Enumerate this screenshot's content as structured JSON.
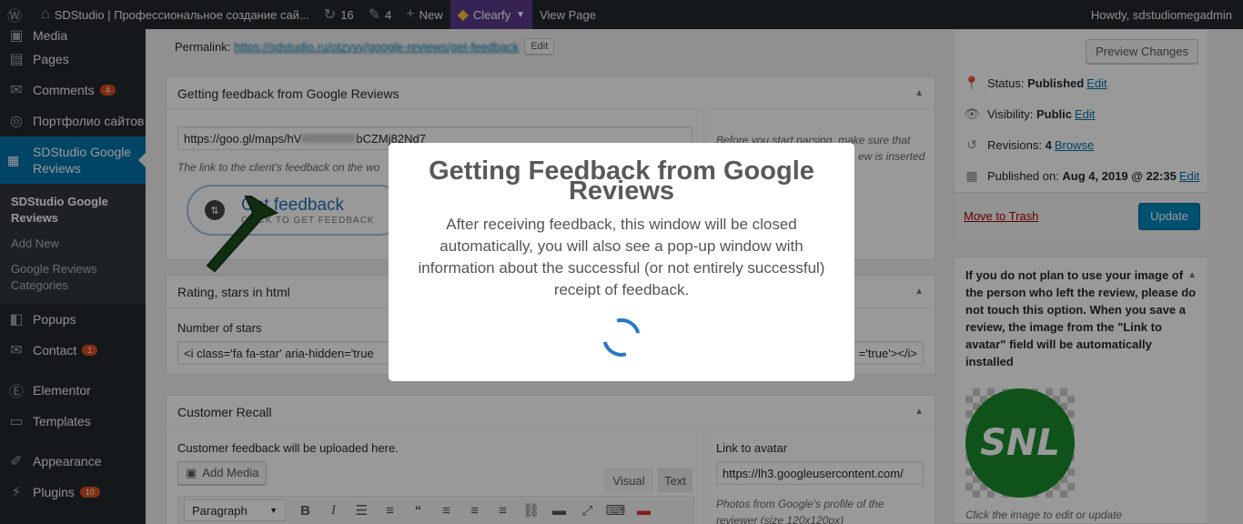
{
  "adminbar": {
    "wp_logo": "wordpress-icon",
    "site_title": "SDStudio | Профессиональное создание сай...",
    "updates": "16",
    "comments": "4",
    "new_label": "New",
    "clearfy_label": "Clearfy",
    "view_page": "View Page",
    "howdy": "Howdy, sdstudiomegadmin"
  },
  "menu": {
    "top_items": [
      {
        "label": "Media",
        "icon": "media-icon"
      },
      {
        "label": "Pages",
        "icon": "pages-icon"
      },
      {
        "label": "Comments",
        "icon": "comments-icon",
        "badge": "4"
      },
      {
        "label": "Портфолио сайтов",
        "icon": "portfolio-icon"
      }
    ],
    "current": {
      "label": "SDStudio Google Reviews",
      "icon": "reviews-icon"
    },
    "submenu": [
      "SDStudio Google Reviews",
      "Add New",
      "Google Reviews Categories"
    ],
    "bottom_items": [
      {
        "label": "Popups",
        "icon": "popups-icon"
      },
      {
        "label": "Contact",
        "icon": "contact-icon",
        "badge": "1"
      },
      {
        "label": "Elementor",
        "icon": "elementor-icon"
      },
      {
        "label": "Templates",
        "icon": "templates-icon"
      },
      {
        "label": "Appearance",
        "icon": "appearance-icon"
      },
      {
        "label": "Plugins",
        "icon": "plugins-icon",
        "badge": "10"
      }
    ]
  },
  "permalink": {
    "label": "Permalink:",
    "url": "https://sdstudio.ru/otzyvy/google-reviews/get-feedback",
    "edit": "Edit"
  },
  "feedback_box": {
    "title": "Getting feedback from Google Reviews",
    "url_value": "https://goo.gl/maps/hV",
    "url_value_tail": "bCZMj82Nd7",
    "hint": "The link to the client's feedback on the wo",
    "side_note": "Before you start parsing, make sure that",
    "side_note_2": "ew is inserted",
    "button_title": "Get feedback",
    "button_sub": "CLICK TO GET FEEDBACK"
  },
  "rating_box": {
    "title": "Rating, stars in html",
    "label": "Number of stars",
    "value": "<i class='fa fa-star' aria-hidden='true",
    "value_right": "='true'></i>"
  },
  "recall_box": {
    "title": "Customer Recall",
    "desc": "Customer feedback will be uploaded here.",
    "add_media": "Add Media",
    "tab_visual": "Visual",
    "tab_text": "Text",
    "format": "Paragraph",
    "avatar_label": "Link to avatar",
    "avatar_value": "https://lh3.googleusercontent.com/",
    "avatar_note": "Photos from Google's profile of the reviewer (size 120x120px)"
  },
  "publish": {
    "preview": "Preview Changes",
    "status_label": "Status:",
    "status_value": "Published",
    "visibility_label": "Visibility:",
    "visibility_value": "Public",
    "revisions_label": "Revisions:",
    "revisions_value": "4",
    "browse": "Browse",
    "published_label": "Published on:",
    "published_value": "Aug 4, 2019 @ 22:35",
    "edit": "Edit",
    "trash": "Move to Trash",
    "update": "Update"
  },
  "image_box": {
    "text": "If you do not plan to use your image of the person who left the review, please do not touch this option. When you save a review, the image from the \"Link to avatar\" field will be automatically installed",
    "footer": "Click the image to edit or update",
    "logo_text": "SNL"
  },
  "modal": {
    "title": "Getting Feedback from Google Reviews",
    "body": "After receiving feedback, this window will be closed automatically, you will also see a pop-up window with information about the successful (or not entirely successful) receipt of feedback."
  },
  "colors": {
    "accent": "#0073aa",
    "spinner": "#2778c4",
    "logo_green": "#1a8a2e"
  }
}
